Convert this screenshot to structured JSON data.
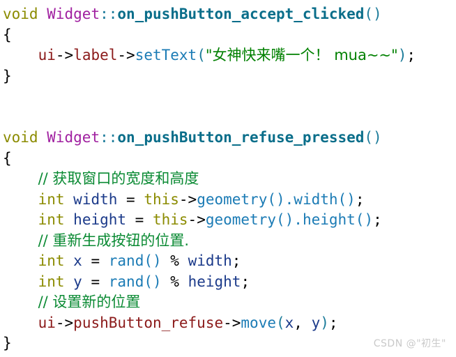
{
  "editor": {
    "background_color": "#ffffff",
    "language": "cpp",
    "colors": {
      "keyword": "#8b8b00",
      "class": "#a020a0",
      "function_definition": "#0a6e8a",
      "function_call": "#1b7bb5",
      "member": "#8b1a1a",
      "string": "#008000",
      "comment": "#0a8a33",
      "variable": "#1b3a8a",
      "punctuation": "#000000"
    }
  },
  "code": {
    "line01": {
      "kw": "void",
      "space1": " ",
      "cls": "Widget",
      "scope": "::",
      "fn": "on_pushButton_accept_clicked",
      "parens": "()"
    },
    "line02": {
      "text": "{"
    },
    "line03": {
      "indent": "    ",
      "obj": "ui",
      "arrow1": "->",
      "member": "label",
      "arrow2": "->",
      "call": "setText",
      "open": "(",
      "string": "\"女神快来嘴一个！ mua~~\"",
      "close": ")",
      "semi": ";"
    },
    "line04": {
      "text": "}"
    },
    "line05": {
      "text": ""
    },
    "line06": {
      "text": ""
    },
    "line07": {
      "kw": "void",
      "space1": " ",
      "cls": "Widget",
      "scope": "::",
      "fn": "on_pushButton_refuse_pressed",
      "parens": "()"
    },
    "line08": {
      "text": "{"
    },
    "line09": {
      "indent": "    ",
      "comment": "// 获取窗口的宽度和高度"
    },
    "line10": {
      "indent": "    ",
      "kw": "int",
      "space1": " ",
      "var": "width",
      "assign": " = ",
      "this": "this",
      "arrow": "->",
      "call1": "geometry",
      "parens1": "().",
      "call2": "width",
      "parens2": "()",
      "semi": ";"
    },
    "line11": {
      "indent": "    ",
      "kw": "int",
      "space1": " ",
      "var": "height",
      "assign": " = ",
      "this": "this",
      "arrow": "->",
      "call1": "geometry",
      "parens1": "().",
      "call2": "height",
      "parens2": "()",
      "semi": ";"
    },
    "line12": {
      "indent": "    ",
      "comment": "// 重新生成按钮的位置."
    },
    "line13": {
      "indent": "    ",
      "kw": "int",
      "space1": " ",
      "var": "x",
      "assign": " = ",
      "call": "rand",
      "parens": "()",
      "op": " % ",
      "var2": "width",
      "semi": ";"
    },
    "line14": {
      "indent": "    ",
      "kw": "int",
      "space1": " ",
      "var": "y",
      "assign": " = ",
      "call": "rand",
      "parens": "()",
      "op": " % ",
      "var2": "height",
      "semi": ";"
    },
    "line15": {
      "indent": "    ",
      "comment": "// 设置新的位置"
    },
    "line16": {
      "indent": "    ",
      "obj": "ui",
      "arrow1": "->",
      "member": "pushButton_refuse",
      "arrow2": "->",
      "call": "move",
      "open": "(",
      "argx": "x",
      "comma": ", ",
      "argy": "y",
      "close": ")",
      "semi": ";"
    },
    "line17": {
      "text": "}"
    }
  },
  "watermark": {
    "text": "CSDN @\"初生\""
  }
}
